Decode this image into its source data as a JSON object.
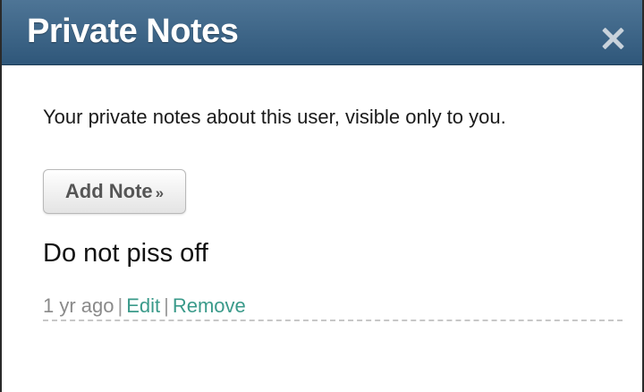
{
  "modal": {
    "title": "Private Notes",
    "close_symbol": "close-icon"
  },
  "body": {
    "intro": "Your private notes about this user, visible only to you.",
    "add_button_label": "Add Note",
    "add_button_arrow": "»"
  },
  "notes": [
    {
      "text": "Do not piss off",
      "time": "1 yr ago",
      "edit_label": "Edit",
      "remove_label": "Remove"
    }
  ],
  "colors": {
    "header_blue": "#3d6587",
    "link_teal": "#3a9a8a"
  }
}
